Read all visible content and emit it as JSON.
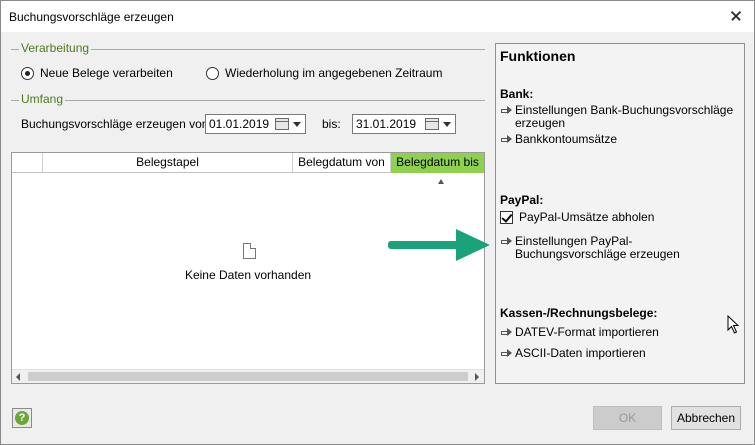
{
  "window": {
    "title": "Buchungsvorschläge erzeugen"
  },
  "verarbeitung": {
    "group_label": "Verarbeitung",
    "options": [
      {
        "label": "Neue Belege verarbeiten",
        "selected": true
      },
      {
        "label": "Wiederholung im angegebenen Zeitraum",
        "selected": false
      }
    ]
  },
  "umfang": {
    "group_label": "Umfang",
    "from_label": "Buchungsvorschläge erzeugen von:",
    "from_value": "01.01.2019",
    "to_label": "bis:",
    "to_value": "31.01.2019"
  },
  "grid": {
    "columns": [
      "",
      "Belegstapel",
      "Belegdatum von",
      "Belegdatum bis"
    ],
    "sorted_column": "Belegdatum bis",
    "sort_direction": "ascending",
    "empty_text": "Keine Daten vorhanden"
  },
  "panel": {
    "title": "Funktionen",
    "bank": {
      "title": "Bank:",
      "links": [
        "Einstellungen Bank-Buchungsvorschläge erzeugen",
        "Bankkontoumsätze"
      ]
    },
    "paypal": {
      "title": "PayPal:",
      "checkbox_label": "PayPal-Umsätze abholen",
      "checkbox_checked": true,
      "link": "Einstellungen PayPal-Buchungsvorschläge erzeugen"
    },
    "kassen": {
      "title": "Kassen-/Rechnungsbelege:",
      "links": [
        "DATEV-Format importieren",
        "ASCII-Daten importieren"
      ]
    }
  },
  "footer": {
    "help_glyph": "?",
    "ok_label": "OK",
    "ok_enabled": false,
    "cancel_label": "Abbrechen"
  },
  "colors": {
    "group_label": "#4f7a1f",
    "sorted_header": "#8fd14f",
    "annotation_arrow": "#1aa37a"
  }
}
